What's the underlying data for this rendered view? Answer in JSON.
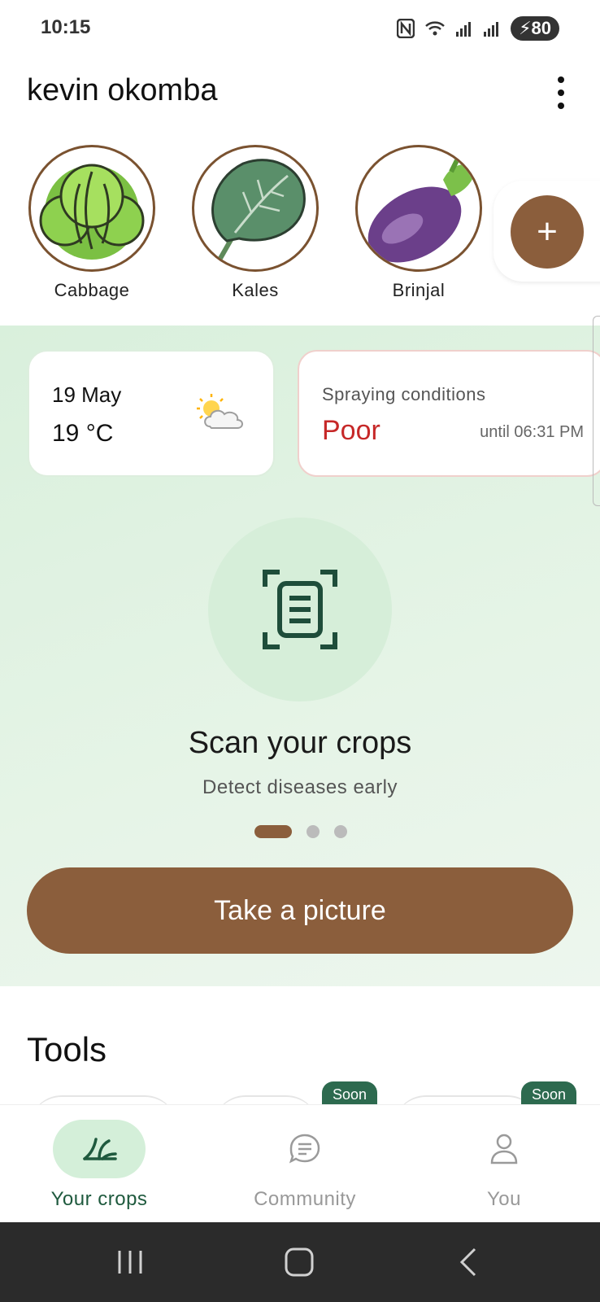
{
  "status_bar": {
    "time": "10:15",
    "battery": "80"
  },
  "header": {
    "user_name": "kevin okomba"
  },
  "crops": [
    {
      "label": "Cabbage",
      "icon": "cabbage-icon"
    },
    {
      "label": "Kales",
      "icon": "kale-icon"
    },
    {
      "label": "Brinjal",
      "icon": "eggplant-icon"
    }
  ],
  "add_crop": {
    "label": "+"
  },
  "weather": {
    "date": "19 May",
    "temperature": "19 °C",
    "icon": "partly-cloudy-icon"
  },
  "spraying": {
    "label": "Spraying conditions",
    "value": "Poor",
    "until": "until 06:31 PM"
  },
  "scan": {
    "title": "Scan your crops",
    "subtitle": "Detect diseases early",
    "icon": "scan-document-icon"
  },
  "pager": {
    "count": 3,
    "active_index": 0
  },
  "primary_action": {
    "label": "Take a picture"
  },
  "tools": {
    "title": "Tools",
    "badges": [
      "Soon",
      "Soon"
    ]
  },
  "bottom_nav": {
    "items": [
      {
        "label": "Your crops",
        "icon": "sprout-icon",
        "active": true
      },
      {
        "label": "Community",
        "icon": "chat-bubble-icon",
        "active": false
      },
      {
        "label": "You",
        "icon": "person-icon",
        "active": false
      }
    ]
  },
  "colors": {
    "brand_brown": "#8b5e3c",
    "green_bg": "#d9f0dc",
    "active_green": "#1f5a3e",
    "poor_red": "#c62828",
    "badge_green": "#2d6a4f"
  }
}
